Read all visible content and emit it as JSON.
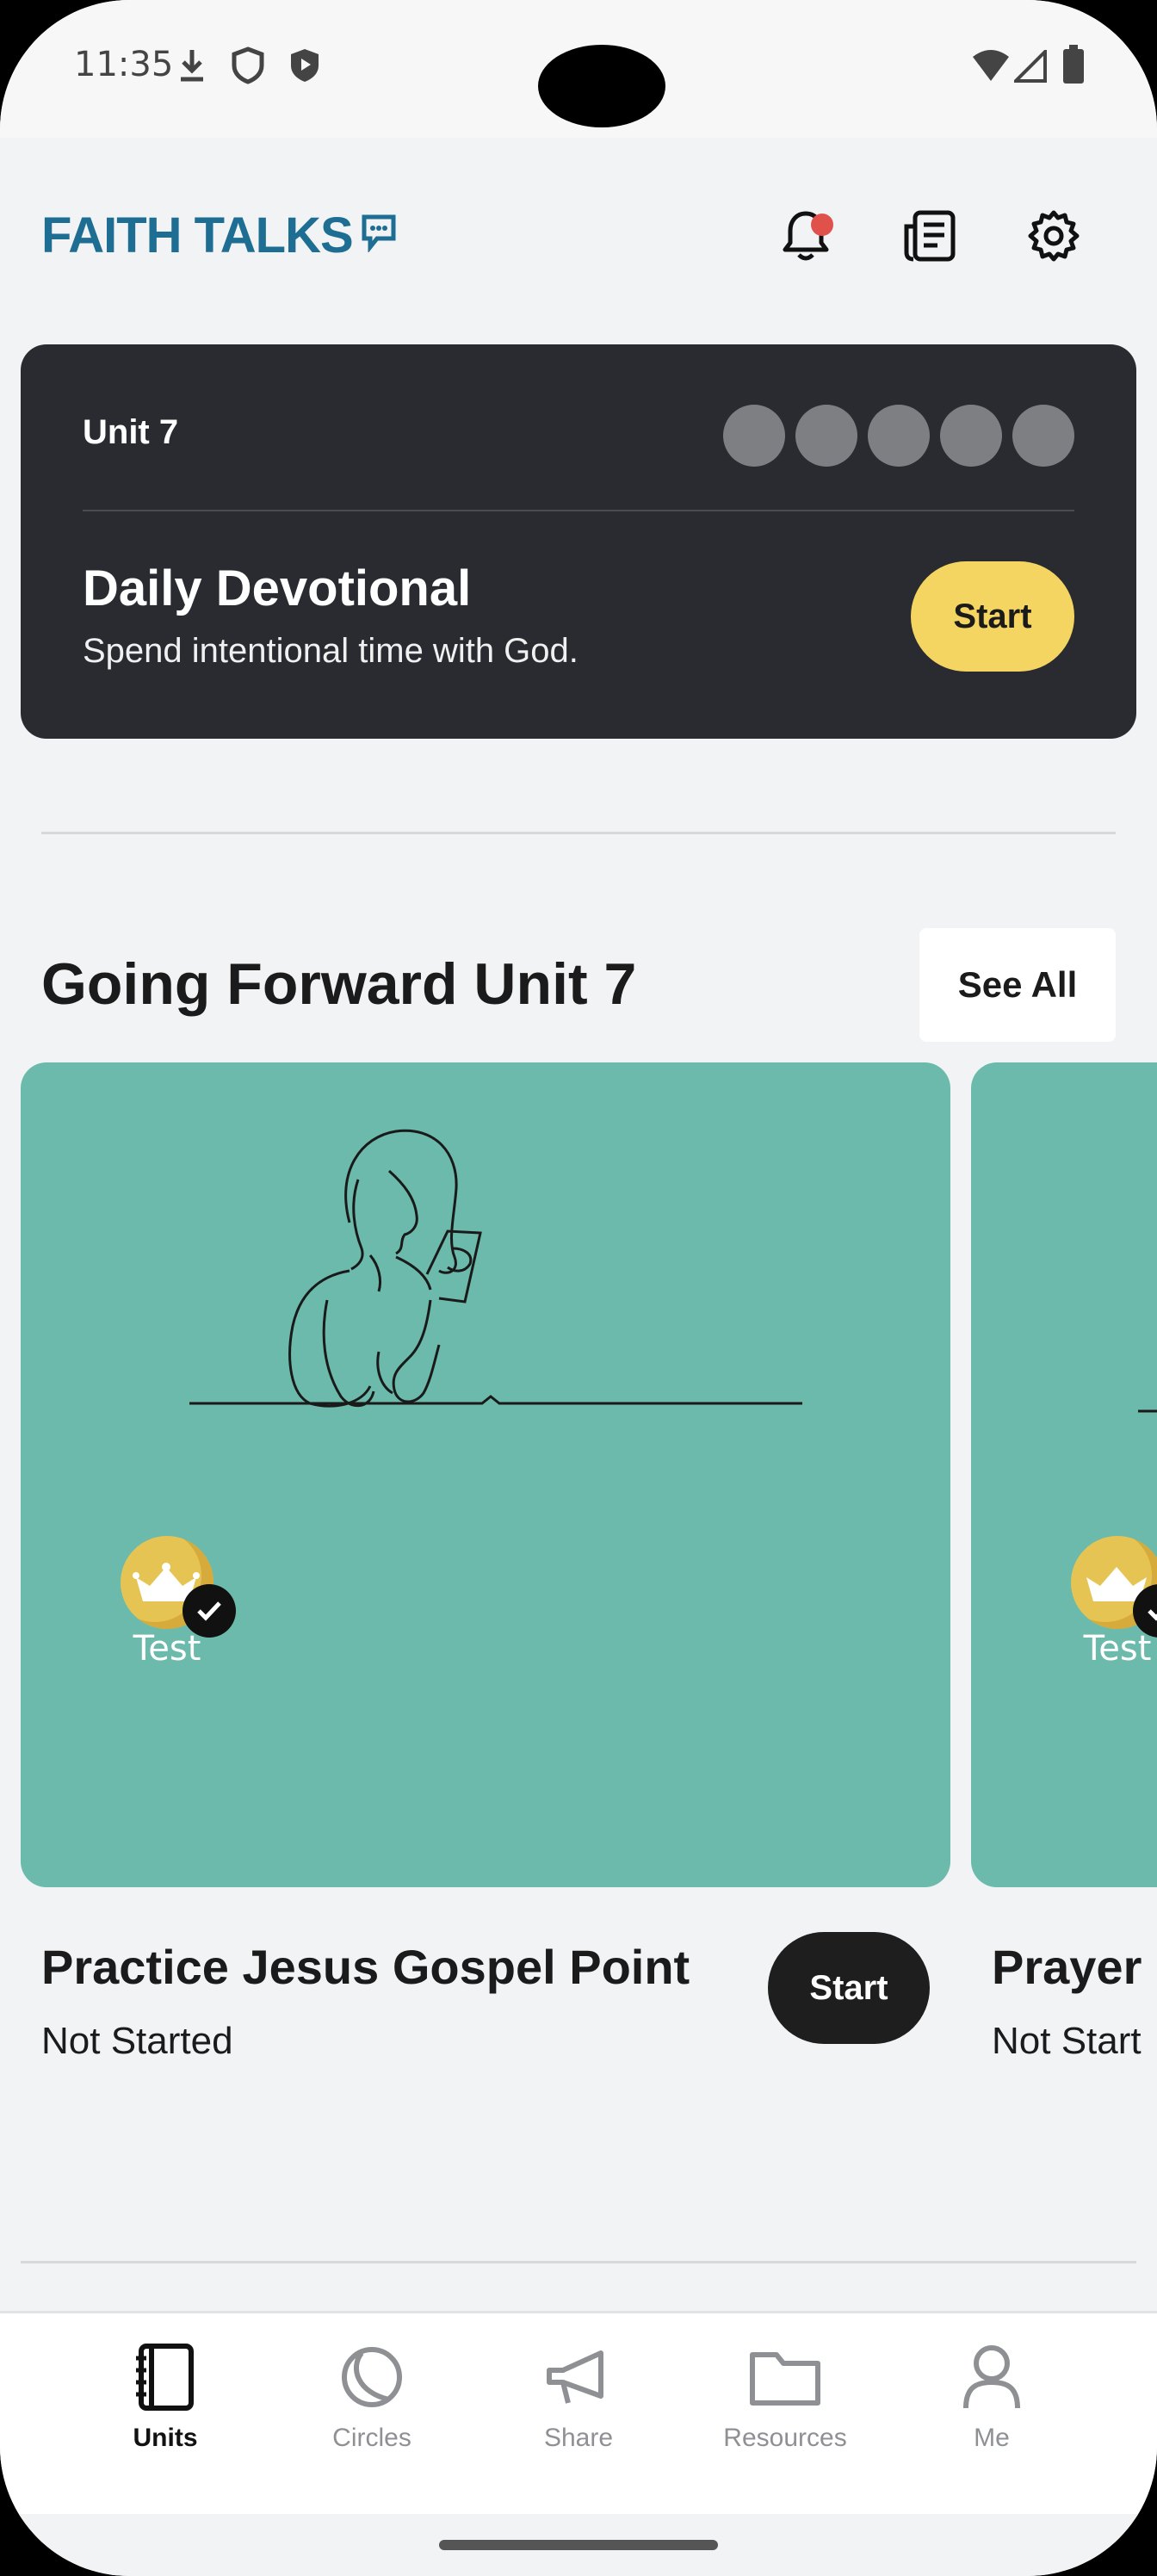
{
  "status_bar": {
    "time": "11:35",
    "left_icons": [
      "download-icon",
      "shield-icon",
      "shield-play-icon"
    ],
    "right_icons": [
      "wifi-icon",
      "signal-icon",
      "battery-icon"
    ]
  },
  "header": {
    "logo_text": "FAITH TALKS",
    "notification_badge_color": "#e0514b",
    "icons": [
      "bell-icon",
      "news-icon",
      "gear-icon"
    ]
  },
  "devotional": {
    "unit_label": "Unit 7",
    "progress_dots_total": 5,
    "progress_dots_completed": 0,
    "title": "Daily Devotional",
    "subtitle": "Spend intentional time with God.",
    "start_label": "Start"
  },
  "section": {
    "title": "Going Forward Unit 7",
    "see_all_label": "See All"
  },
  "cards": [
    {
      "badge_label": "Test",
      "title": "Practice Jesus Gospel Point",
      "status": "Not Started",
      "start_label": "Start"
    },
    {
      "badge_label": "Test",
      "title": "Prayer",
      "status": "Not Start"
    }
  ],
  "bottom_nav": [
    {
      "label": "Units",
      "icon": "notebook-icon",
      "active": true
    },
    {
      "label": "Circles",
      "icon": "circles-icon",
      "active": false
    },
    {
      "label": "Share",
      "icon": "megaphone-icon",
      "active": false
    },
    {
      "label": "Resources",
      "icon": "folder-icon",
      "active": false
    },
    {
      "label": "Me",
      "icon": "person-icon",
      "active": false
    }
  ],
  "colors": {
    "background": "#f2f3f5",
    "devotional_card": "#292b30",
    "accent_yellow": "#f5d561",
    "card_teal": "#6bbaac",
    "logo_blue": "#1e6e93"
  }
}
